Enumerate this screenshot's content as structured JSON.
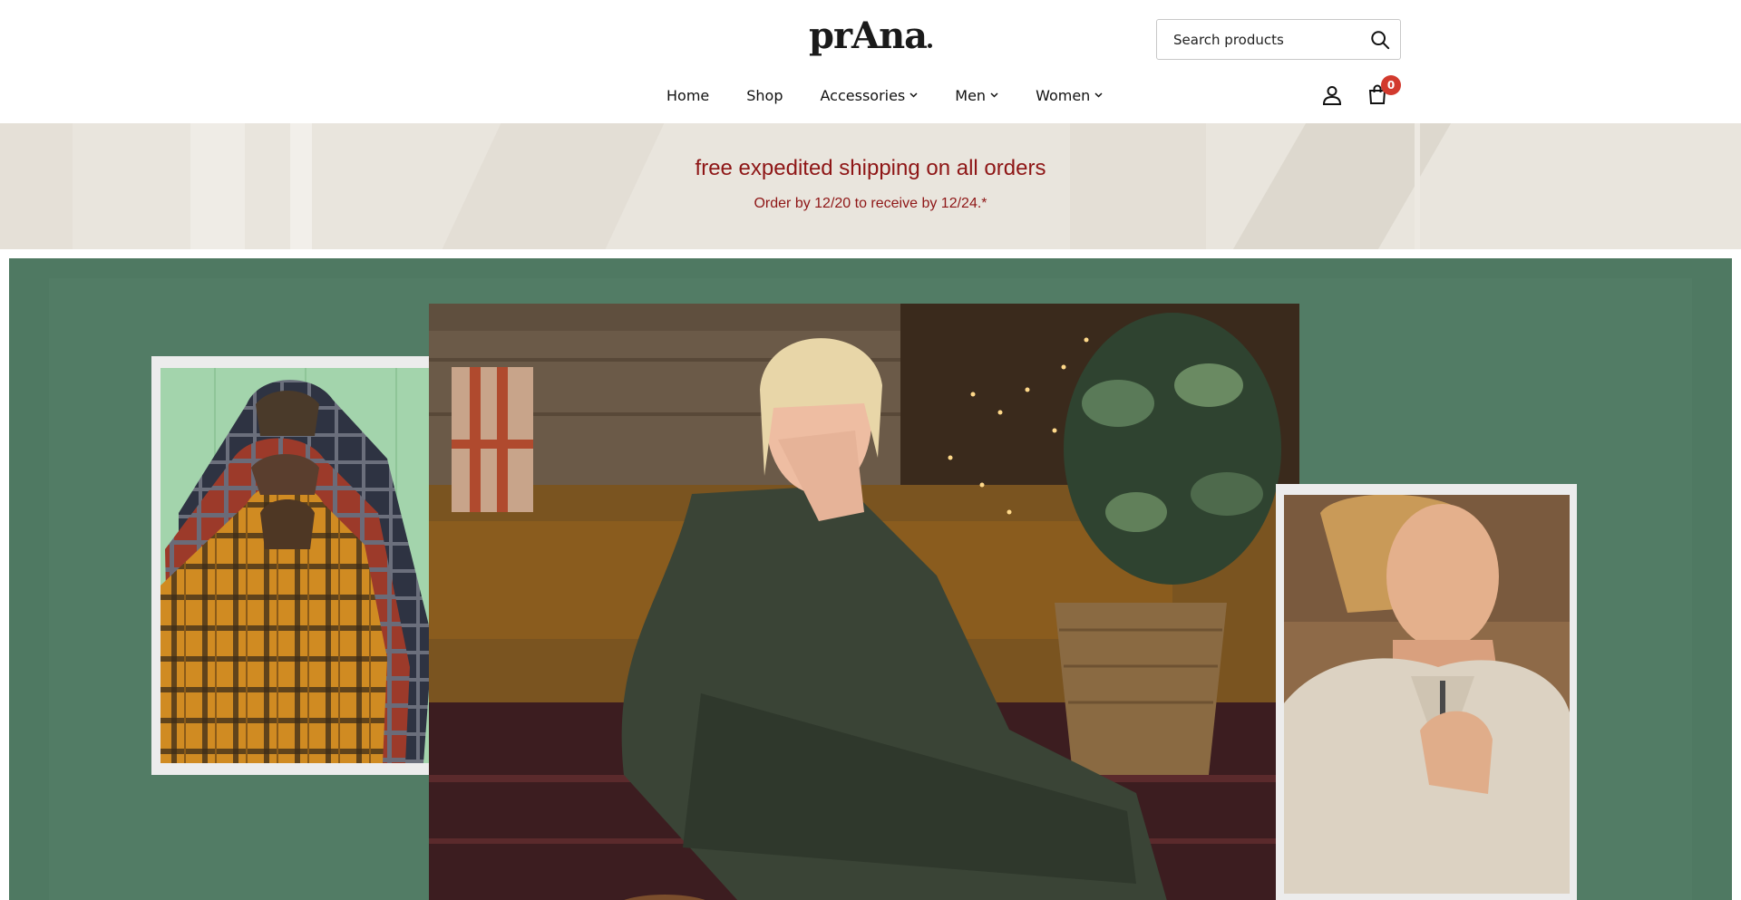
{
  "brand": {
    "logo_text": "prAna"
  },
  "search": {
    "placeholder": "Search products"
  },
  "nav": {
    "items": [
      {
        "label": "Home",
        "has_dropdown": false
      },
      {
        "label": "Shop",
        "has_dropdown": false
      },
      {
        "label": "Accessories",
        "has_dropdown": true
      },
      {
        "label": "Men",
        "has_dropdown": true
      },
      {
        "label": "Women",
        "has_dropdown": true
      }
    ]
  },
  "cart": {
    "count": "0"
  },
  "promo": {
    "title": "free expedited shipping on all orders",
    "subtitle": "Order by 12/20 to receive by 12/24.*"
  },
  "colors": {
    "promo_text": "#8e1616",
    "hero_bg": "#4f7962",
    "badge": "#d23a2e"
  },
  "icons": {
    "search": "search-icon",
    "account": "user-icon",
    "cart": "shopping-bag-icon",
    "dropdown": "chevron-down-icon"
  }
}
